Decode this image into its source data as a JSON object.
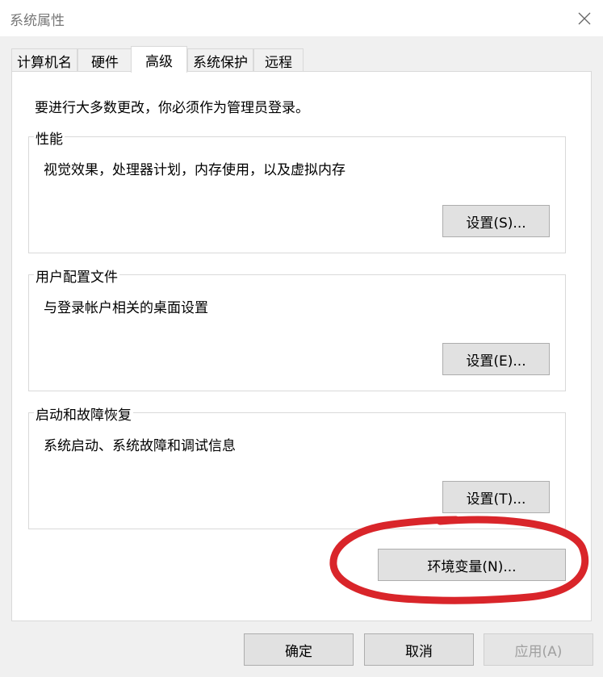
{
  "window": {
    "title": "系统属性"
  },
  "tabs": [
    {
      "label": "计算机名",
      "active": false
    },
    {
      "label": "硬件",
      "active": false
    },
    {
      "label": "高级",
      "active": true
    },
    {
      "label": "系统保护",
      "active": false
    },
    {
      "label": "远程",
      "active": false
    }
  ],
  "advanced": {
    "admin_note": "要进行大多数更改，你必须作为管理员登录。",
    "performance": {
      "title": "性能",
      "description": "视觉效果，处理器计划，内存使用，以及虚拟内存",
      "button": "设置(S)..."
    },
    "user_profiles": {
      "title": "用户配置文件",
      "description": "与登录帐户相关的桌面设置",
      "button": "设置(E)..."
    },
    "startup_recovery": {
      "title": "启动和故障恢复",
      "description": "系统启动、系统故障和调试信息",
      "button": "设置(T)..."
    },
    "env_button": "环境变量(N)..."
  },
  "footer": {
    "ok": "确定",
    "cancel": "取消",
    "apply": "应用(A)"
  },
  "colors": {
    "highlight_circle": "#d9252a",
    "panel_bg": "#ffffff",
    "dialog_bg": "#f0f0f0"
  },
  "icons": {
    "close": "close-icon"
  }
}
